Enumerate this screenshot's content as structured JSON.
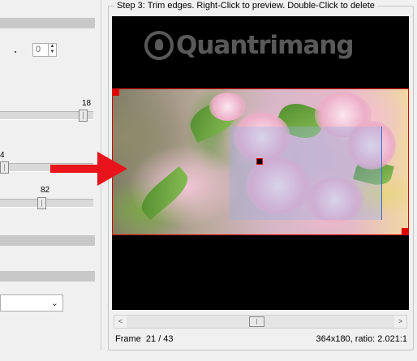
{
  "left_panel": {
    "spin_value": "0",
    "slider_1": {
      "label": "18",
      "level_percent": 90
    },
    "slider_2": {
      "label": "4",
      "level_percent": 4
    },
    "slider_3": {
      "label": "82",
      "level_percent": 45
    },
    "dropdown": {
      "selected": ""
    }
  },
  "step_group": {
    "title": "Step 3: Trim edges. Right-Click to preview. Double-Click to delete"
  },
  "preview": {
    "watermark": "Quantrimang"
  },
  "scrollbar": {
    "left_arrow": "<",
    "right_arrow": ">",
    "position_percent": 49
  },
  "status": {
    "frame_label": "Frame",
    "frame_value": "21 / 43",
    "size_info": "364x180, ratio: 2.021:1"
  },
  "colors": {
    "crop_border": "#e00000",
    "annotation_arrow": "#e8131b",
    "selection": "#3b6fd0"
  },
  "icons": {
    "annotation": "arrow-right-icon",
    "watermark_logo": "lightbulb-icon"
  }
}
